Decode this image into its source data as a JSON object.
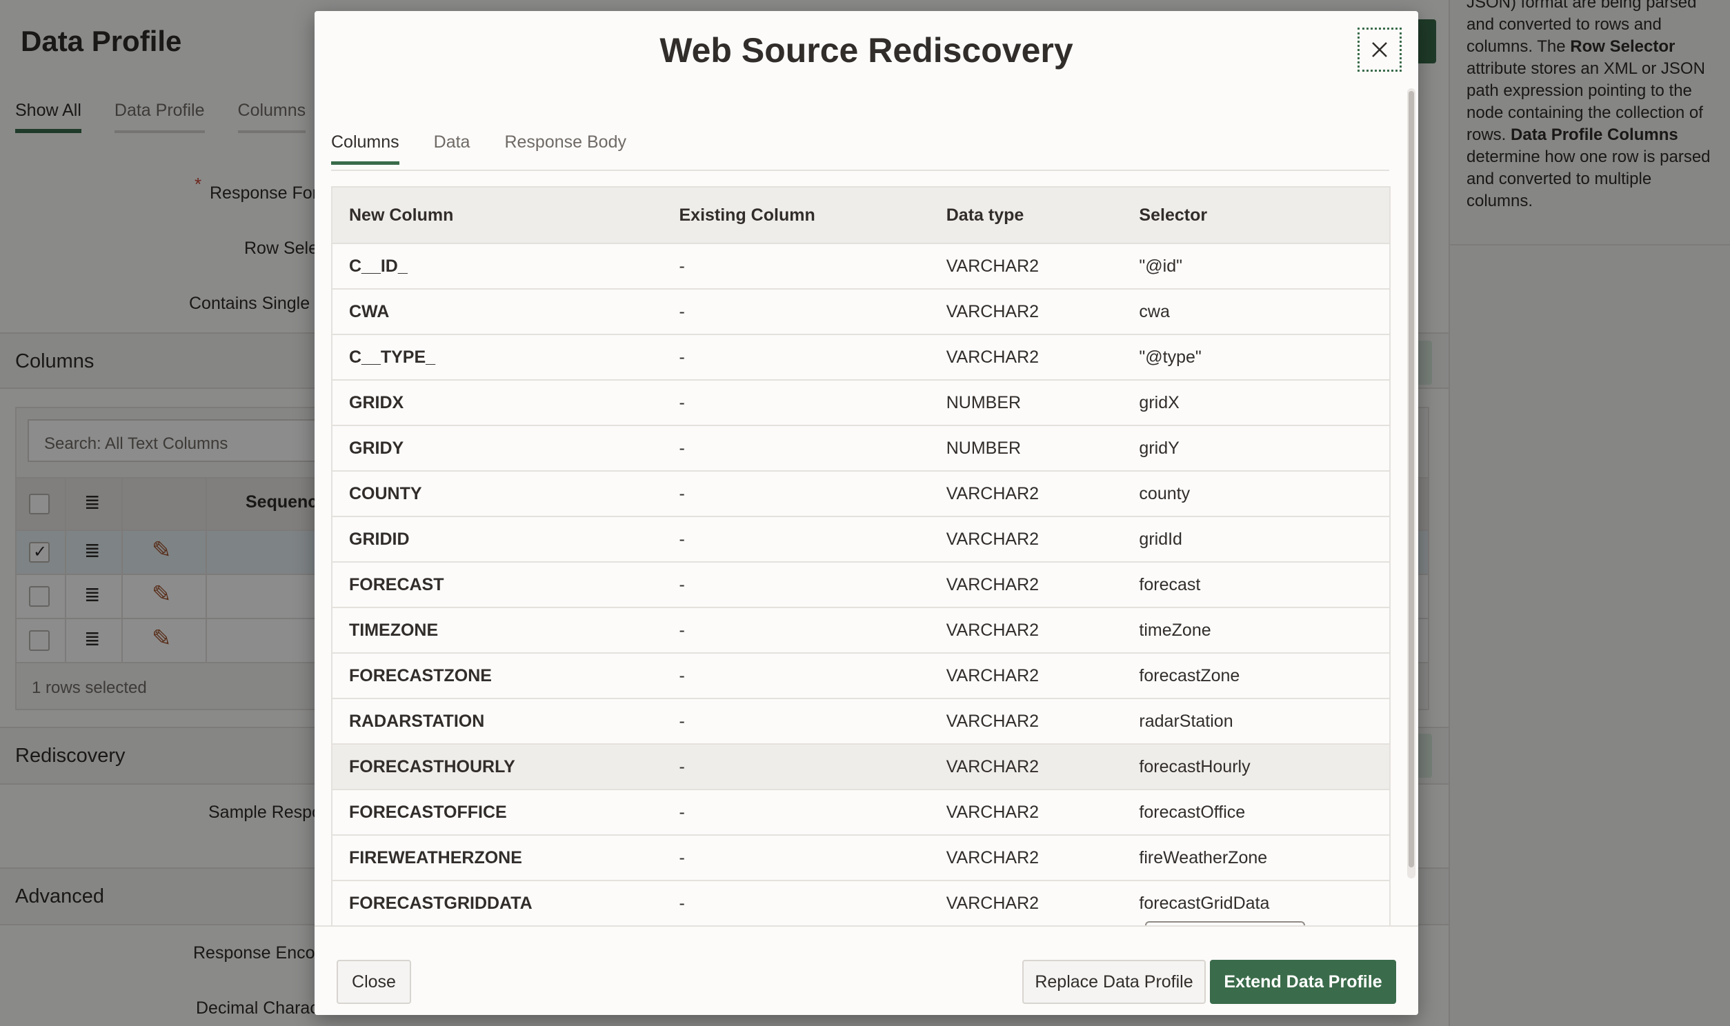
{
  "background": {
    "page_title": "Data Profile",
    "tabs": [
      "Show All",
      "Data Profile",
      "Columns"
    ],
    "fields": {
      "response_format": "Response Forr",
      "row_selector": "Row Selec",
      "contains_single": "Contains Single F",
      "sample_response": "Sample Respo",
      "response_encoding": "Response Encod",
      "decimal_character": "Decimal Charact"
    },
    "sections": {
      "columns": "Columns",
      "rediscovery": "Rediscovery",
      "advanced": "Advanced"
    },
    "grid": {
      "search_placeholder": "Search: All Text Columns",
      "sequence_header": "Sequenc",
      "rows_selected": "1 rows selected"
    },
    "help": {
      "line1": "JSON) format are being parsed and converted to rows and columns. The ",
      "bold1": "Row Selector",
      "line2": " attribute stores an XML or JSON path expression pointing to the node containing the collection of rows. ",
      "bold2": "Data Profile Columns",
      "line3": " determine how one row is parsed and converted to multiple columns."
    }
  },
  "dialog": {
    "title": "Web Source Rediscovery",
    "tabs": [
      "Columns",
      "Data",
      "Response Body"
    ],
    "active_tab": "Columns",
    "table": {
      "headers": [
        "New Column",
        "Existing Column",
        "Data type",
        "Selector"
      ],
      "rows": [
        [
          "C__ID_",
          "-",
          "VARCHAR2",
          "\"@id\""
        ],
        [
          "CWA",
          "-",
          "VARCHAR2",
          "cwa"
        ],
        [
          "C__TYPE_",
          "-",
          "VARCHAR2",
          "\"@type\""
        ],
        [
          "GRIDX",
          "-",
          "NUMBER",
          "gridX"
        ],
        [
          "GRIDY",
          "-",
          "NUMBER",
          "gridY"
        ],
        [
          "COUNTY",
          "-",
          "VARCHAR2",
          "county"
        ],
        [
          "GRIDID",
          "-",
          "VARCHAR2",
          "gridId"
        ],
        [
          "FORECAST",
          "-",
          "VARCHAR2",
          "forecast"
        ],
        [
          "TIMEZONE",
          "-",
          "VARCHAR2",
          "timeZone"
        ],
        [
          "FORECASTZONE",
          "-",
          "VARCHAR2",
          "forecastZone"
        ],
        [
          "RADARSTATION",
          "-",
          "VARCHAR2",
          "radarStation"
        ],
        [
          "FORECASTHOURLY",
          "-",
          "VARCHAR2",
          "forecastHourly"
        ],
        [
          "FORECASTOFFICE",
          "-",
          "VARCHAR2",
          "forecastOffice"
        ],
        [
          "FIREWEATHERZONE",
          "-",
          "VARCHAR2",
          "fireWeatherZone"
        ],
        [
          "FORECASTGRIDDATA",
          "-",
          "VARCHAR2",
          "forecastGridData"
        ]
      ],
      "highlighted_row": "FORECASTHOURLY"
    },
    "buttons": {
      "close": "Close",
      "replace": "Replace Data Profile",
      "extend": "Extend Data Profile"
    }
  },
  "colors": {
    "accent": "#3a6b4a",
    "text": "#312d2a",
    "required": "#c74634"
  }
}
